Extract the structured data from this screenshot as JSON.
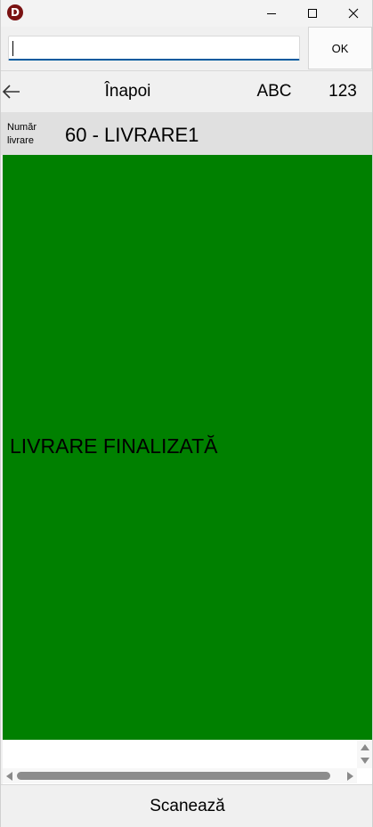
{
  "window": {
    "icon_letter": "D",
    "colors": {
      "status_panel": "#008000",
      "title_icon": "#7a1212"
    }
  },
  "input": {
    "value": "",
    "ok_label": "OK"
  },
  "nav": {
    "back_icon": "arrow-left-icon",
    "back_label": "Înapoi",
    "abc_label": "ABC",
    "num_label": "123"
  },
  "delivery": {
    "label": "Număr livrare",
    "value": "60 - LIVRARE1"
  },
  "status": {
    "text": "LIVRARE FINALIZATĂ"
  },
  "footer": {
    "scan_label": "Scanează"
  }
}
